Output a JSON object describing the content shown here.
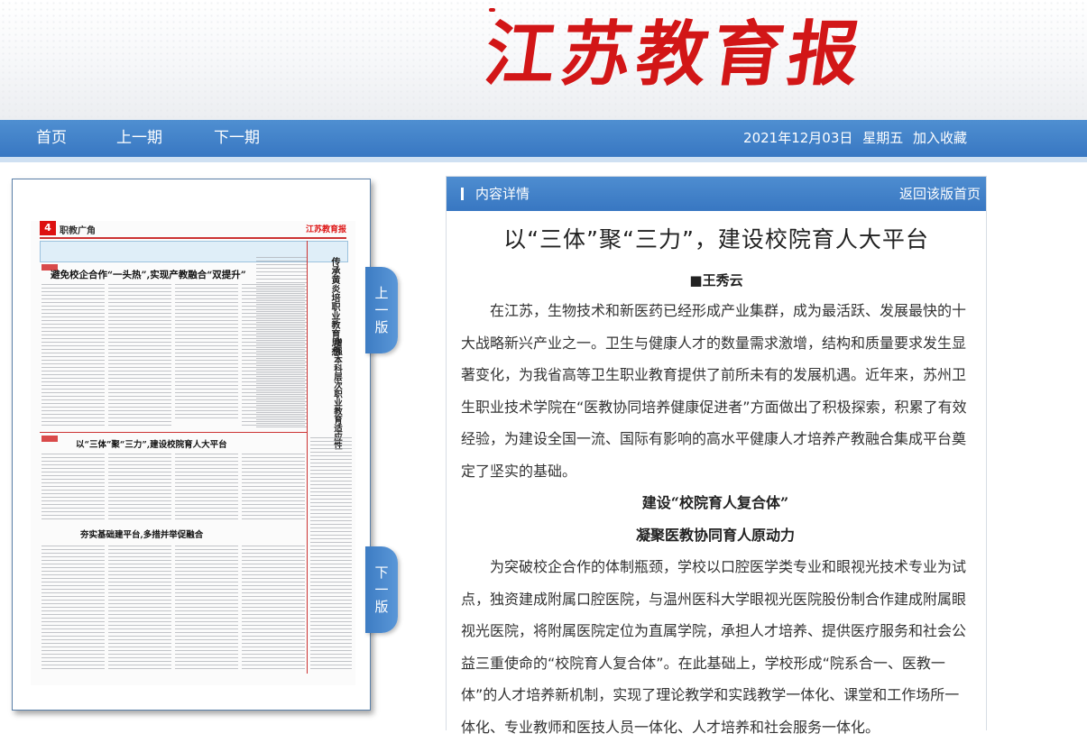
{
  "masthead": {
    "logo_text": "江苏教育报"
  },
  "nav": {
    "home": "首页",
    "prev_issue": "上一期",
    "next_issue": "下一期",
    "date": "2021年12月03日",
    "weekday": "星期五",
    "bookmark": "加入收藏"
  },
  "thumbnail": {
    "page_number": "4",
    "section": "职教广角",
    "brand": "江苏教育报",
    "headline_1": "避免校企合作“一头热”,实现产教融合“双提升”",
    "headline_2": "以“三体”聚“三力”,建设校院育人大平台",
    "headline_3": "夯实基础建平台,多措并举促融合",
    "vertical_headline": "传承黄炎培职业教育思想",
    "vertical_headline_2": "增强本科层次职业教育适应性"
  },
  "side_tabs": {
    "prev_page": [
      "上",
      "一",
      "版"
    ],
    "next_page": [
      "下",
      "一",
      "版"
    ]
  },
  "panel": {
    "header_title": "内容详情",
    "back_link": "返回该版首页",
    "article_title": "以“三体”聚“三力”，建设校院育人大平台",
    "byline": "■王秀云",
    "para_1": "在江苏，生物技术和新医药已经形成产业集群，成为最活跃、发展最快的十大战略新兴产业之一。卫生与健康人才的数量需求激增，结构和质量要求发生显著变化，为我省高等卫生职业教育提供了前所未有的发展机遇。近年来，苏州卫生职业技术学院在“医教协同培养健康促进者”方面做出了积极探索，积累了有效经验，为建设全国一流、国际有影响的高水平健康人才培养产教融合集成平台奠定了坚实的基础。",
    "subhead_1": "建设“校院育人复合体”",
    "subhead_2": "凝聚医教协同育人原动力",
    "para_2": "为突破校企合作的体制瓶颈，学校以口腔医学类专业和眼视光技术专业为试点，独资建成附属口腔医院，与温州医科大学眼视光医院股份制合作建成附属眼视光医院，将附属医院定位为直属学院，承担人才培养、提供医疗服务和社会公益三重使命的“校院育人复合体”。在此基础上，学校形成“院系合一、医教一体”的人才培养新机制，实现了理论教学和实践教学一体化、课堂和工作场所一体化、专业教师和医技人员一体化、人才培养和社会服务一体化。"
  }
}
